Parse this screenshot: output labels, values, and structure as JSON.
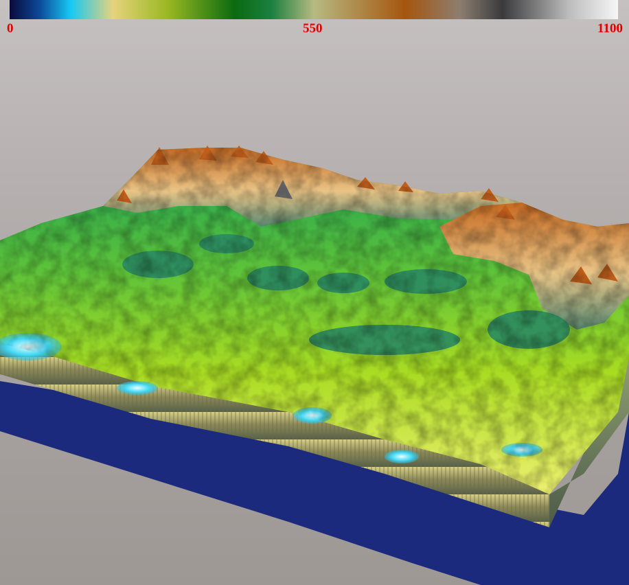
{
  "colorbar": {
    "min_label": "0",
    "mid_label": "550",
    "max_label": "1100",
    "label_color": "#e00000",
    "stops": [
      {
        "offset": 0.0,
        "color": "#0a0a3a"
      },
      {
        "offset": 0.05,
        "color": "#0c4a9a"
      },
      {
        "offset": 0.1,
        "color": "#17c8f4"
      },
      {
        "offset": 0.17,
        "color": "#e6d37c"
      },
      {
        "offset": 0.26,
        "color": "#9ab822"
      },
      {
        "offset": 0.37,
        "color": "#0a6a10"
      },
      {
        "offset": 0.43,
        "color": "#1a8040"
      },
      {
        "offset": 0.5,
        "color": "#b6ba82"
      },
      {
        "offset": 0.65,
        "color": "#a6560e"
      },
      {
        "offset": 0.74,
        "color": "#8c7e70"
      },
      {
        "offset": 0.81,
        "color": "#3a3a3c"
      },
      {
        "offset": 0.92,
        "color": "#bdbdbd"
      },
      {
        "offset": 1.0,
        "color": "#f6f6f6"
      }
    ]
  },
  "scene": {
    "background_color": "#b3aeac",
    "base_color": "#1c2a7e",
    "terrain_palette": {
      "water": "#40d8f4",
      "lowland": "#eef070",
      "grass": "#8ed81e",
      "forest": "#1aa058",
      "highland": "#5a7a70",
      "mountain": "#d06a20",
      "peak": "#f2e8cc"
    }
  }
}
